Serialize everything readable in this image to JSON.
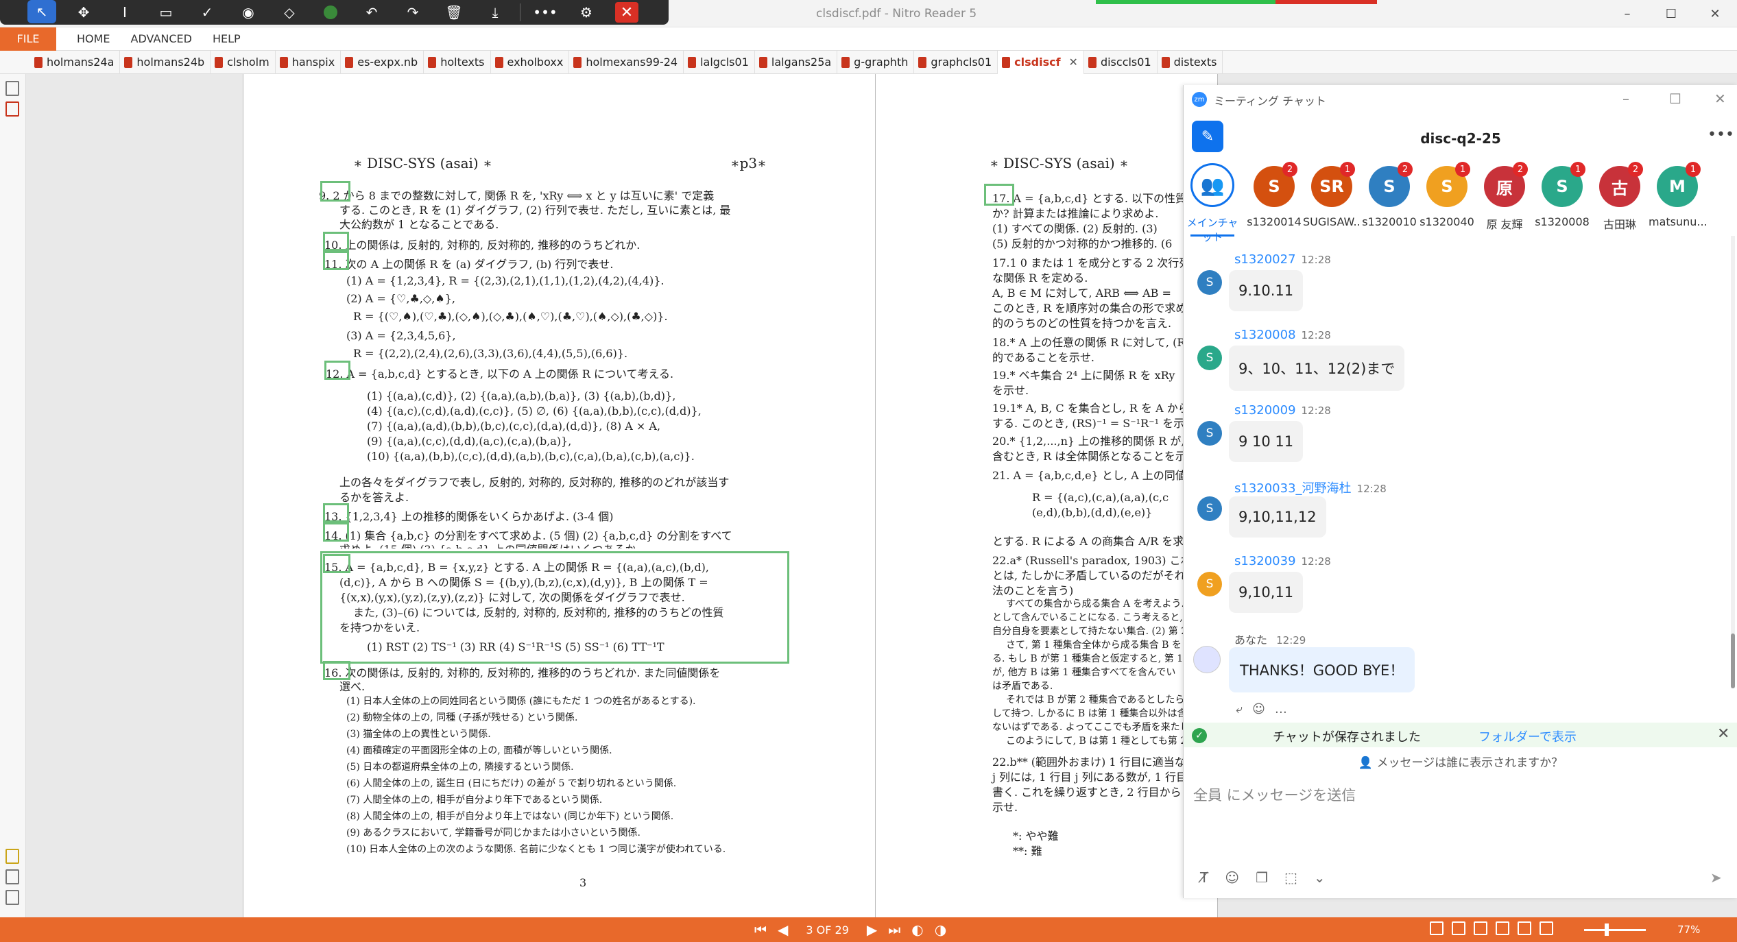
{
  "window": {
    "title": "clsdiscf.pdf - Nitro Reader 5",
    "controls": [
      "–",
      "☐",
      "✕"
    ]
  },
  "floating_toolbar": {
    "icons": [
      "pointer-icon",
      "pan-icon",
      "text-cursor-icon",
      "rectangle-icon",
      "check-icon",
      "record-icon",
      "eraser-icon",
      "color-dot-icon",
      "undo-icon",
      "redo-icon",
      "delete-icon",
      "download-icon",
      "more-icon",
      "user-settings-icon",
      "close-icon"
    ]
  },
  "ribbon": {
    "file": "FILE",
    "tabs": [
      "HOME",
      "ADVANCED",
      "HELP"
    ]
  },
  "doc_tabs": [
    {
      "label": "holmans24a",
      "active": false
    },
    {
      "label": "holmans24b",
      "active": false
    },
    {
      "label": "clsholm",
      "active": false
    },
    {
      "label": "hanspix",
      "active": false
    },
    {
      "label": "es-expx.nb",
      "active": false
    },
    {
      "label": "holtexts",
      "active": false
    },
    {
      "label": "exholboxx",
      "active": false
    },
    {
      "label": "holmexans99-24",
      "active": false
    },
    {
      "label": "lalgcls01",
      "active": false
    },
    {
      "label": "lalgans25a",
      "active": false
    },
    {
      "label": "g-graphth",
      "active": false
    },
    {
      "label": "graphcls01",
      "active": false
    },
    {
      "label": "clsdiscf",
      "active": true
    },
    {
      "label": "disccls01",
      "active": false
    },
    {
      "label": "distexts",
      "active": false
    }
  ],
  "page_left": {
    "header_left": "∗ DISC-SYS (asai) ∗",
    "header_right": "∗p3∗",
    "lines": [
      "9. 2 から 8 までの整数に対して, 関係 R を, 'xRy ⟺ x と y は互いに素' で定義",
      "する. このとき, R を (1) ダイグラフ, (2) 行列で表せ. ただし, 互いに素とは, 最",
      "大公約数が 1 となることである.",
      "10. 上の関係は, 反射的, 対称的, 反対称的, 推移的のうちどれか.",
      "11. 次の A 上の関係 R を (a) ダイグラフ, (b) 行列で表せ.",
      "(1) A = {1,2,3,4}, R = {(2,3),(2,1),(1,1),(1,2),(4,2),(4,4)}.",
      "(2) A = {♡,♣,◇,♠},",
      "R = {(♡,♠),(♡,♣),(◇,♠),(◇,♣),(♠,♡),(♣,♡),(♠,◇),(♣,◇)}.",
      "(3) A = {2,3,4,5,6},",
      "R = {(2,2),(2,4),(2,6),(3,3),(3,6),(4,4),(5,5),(6,6)}.",
      "12. A = {a,b,c,d} とするとき, 以下の A 上の関係 R について考える.",
      "(1) {(a,a),(c,d)},   (2) {(a,a),(a,b),(b,a)},   (3) {(a,b),(b,d)},",
      "(4) {(a,c),(c,d),(a,d),(c,c)},   (5) ∅,   (6) {(a,a),(b,b),(c,c),(d,d)},",
      "(7) {(a,a),(a,d),(b,b),(b,c),(c,c),(d,a),(d,d)},   (8) A × A,",
      "(9) {(a,a),(c,c),(d,d),(a,c),(c,a),(b,a)},",
      "(10) {(a,a),(b,b),(c,c),(d,d),(a,b),(b,c),(c,a),(b,a),(c,b),(a,c)}.",
      "上の各々をダイグラフで表し, 反射的, 対称的, 反対称的, 推移的のどれが該当す",
      "るかを答えよ.",
      "13. {1,2,3,4} 上の推移的関係をいくらかあげよ. (3-4 個)",
      "14. (1) 集合 {a,b,c} の分割をすべて求めよ. (5 個) (2) {a,b,c,d} の分割をすべて",
      "求めよ. (15 個) (3) {a,b,c,d} 上の同値関係はいくつあるか.",
      "15. A = {a,b,c,d}, B = {x,y,z} とする. A 上の関係 R = {(a,a),(a,c),(b,d),",
      "(d,c)}, A から B への関係 S = {(b,y),(b,z),(c,x),(d,y)}, B 上の関係 T =",
      "{(x,x),(y,x),(y,z),(z,y),(z,z)} に対して, 次の関係をダイグラフで表せ.",
      "また, (3)–(6) については, 反射的, 対称的, 反対称的, 推移的のうちどの性質",
      "を持つかをいえ.",
      "(1) RST   (2) TS⁻¹   (3) RR   (4) S⁻¹R⁻¹S   (5) SS⁻¹   (6) TT⁻¹T",
      "16. 次の関係は, 反射的, 対称的, 反対称的, 推移的のうちどれか. また同値関係を",
      "選べ.",
      "(1) 日本人全体の上の同姓同名という関係 (誰にもただ 1 つの姓名があるとする).",
      "(2) 動物全体の上の, 同種 (子孫が残せる) という関係.",
      "(3) 猫全体の上の異性という関係.",
      "(4) 面積確定の平面図形全体の上の, 面積が等しいという関係.",
      "(5) 日本の都道府県全体の上の, 隣接するという関係.",
      "(6) 人間全体の上の, 誕生日 (日にちだけ) の差が 5 で割り切れるという関係.",
      "(7) 人間全体の上の, 相手が自分より年下であるという関係.",
      "(8) 人間全体の上の, 相手が自分より年上ではない (同じか年下) という関係.",
      "(9) あるクラスにおいて, 学籍番号が同じかまたは小さいという関係.",
      "(10) 日本人全体の上の次のような関係. 名前に少なくとも 1 つ同じ漢字が使われている."
    ],
    "page_number": "3"
  },
  "page_right": {
    "header_left": "∗ DISC-SYS (asai) ∗",
    "lines": [
      "17. A = {a,b,c,d} とする. 以下の性質",
      "か? 計算または推論により求めよ.",
      "(1) すべての関係. (2) 反射的. (3)",
      "(5) 反射的かつ対称的かつ推移的. (6",
      "17.1  0 または 1 を成分とする 2 次行列全",
      "な関係 R を定める.",
      "A, B ∈ M に対して, ARB ⟺ AB =",
      "このとき, R を順序対の集合の形で求め",
      "的のうちのどの性質を持つかを言え.",
      "18.* A 上の任意の関係 R に対して, (R",
      "的であることを示せ.",
      "19.* ベキ集合 2⁴ 上に関係 R を xRy ",
      "を示せ.",
      "19.1* A, B, C を集合とし, R を A から",
      "する. このとき, (RS)⁻¹ = S⁻¹R⁻¹ を示",
      "20.* {1,2,...,n} 上の推移的関係 R が,",
      "含むとき, R は全体関係となることを示",
      "21. A = {a,b,c,d,e} とし, A 上の同値関",
      "R = {(a,c),(c,a),(a,a),(c,c",
      "(e,d),(b,b),(d,d),(e,e)}",
      "とする. R による A の商集合 A/R を求",
      "22.a* (Russell's paradox, 1903) これは集",
      "とは, たしかに矛盾しているのだがそれ",
      "法のことを言う)",
      "すべての集合から成る集合 A を考えよう.",
      "として含んでいることになる. こう考えると,",
      "自分自身を要素として持たない集合. (2) 第 2",
      "さて, 第 1 種集合全体から成る集合 B を",
      "る. もし B が第 1 種集合と仮定すると, 第 1",
      "が, 他方 B は第 1 種集合すべてを含んでい",
      "は矛盾である.",
      "それでは B が第 2 種集合であるとしたら",
      "して持つ. しかるに B は第 1 種集合以外は含",
      "ないはずである. よってここでも矛盾を来たし",
      "このようにして, B は第 1 種としても第 2",
      "22.b** (範囲外おまけ) 1 行目に適当な",
      "j 列には, 1 行目 j 列にある数が, 1 行目",
      "書く. これを繰り返すとき, 2 行目から",
      "示せ.",
      "*: やや難",
      "**: 難"
    ]
  },
  "statusbar": {
    "page_indicator": "3 OF 29",
    "zoom": "77%"
  },
  "zoom_chat": {
    "window_title": "ミーティング チャット",
    "logo": "zm",
    "channel_name": "disc-q2-25",
    "main_chat_label": "メインチャット",
    "participants": [
      {
        "initial": "S",
        "name": "s1320014",
        "badge": "2",
        "color": "#d4500f"
      },
      {
        "initial": "SR",
        "name": "SUGISAW...",
        "badge": "1",
        "color": "#d4500f"
      },
      {
        "initial": "S",
        "name": "s1320010",
        "badge": "2",
        "color": "#2f7fc1"
      },
      {
        "initial": "S",
        "name": "s1320040",
        "badge": "1",
        "color": "#f0a020"
      },
      {
        "initial": "原",
        "name": "原 友輝",
        "badge": "2",
        "color": "#c8323a"
      },
      {
        "initial": "S",
        "name": "s1320008",
        "badge": "1",
        "color": "#2aa88a"
      },
      {
        "initial": "古",
        "name": "古田琳",
        "badge": "2",
        "color": "#c8323a"
      },
      {
        "initial": "M",
        "name": "matsunu...",
        "badge": "1",
        "color": "#2aa88a"
      }
    ],
    "messages": [
      {
        "sender": "s1320027",
        "time": "12:28",
        "text": "9.10.11",
        "initial": "S",
        "color": "#2f7fc1"
      },
      {
        "sender": "s1320008",
        "time": "12:28",
        "text": "9、10、11、12(2)まで",
        "initial": "S",
        "color": "#2aa88a"
      },
      {
        "sender": "s1320009",
        "time": "12:28",
        "text": "9 10 11",
        "initial": "S",
        "color": "#2f7fc1"
      },
      {
        "sender": "s1320033_河野海杜",
        "time": "12:28",
        "text": "9,10,11,12",
        "initial": "S",
        "color": "#2f7fc1"
      },
      {
        "sender": "s1320039",
        "time": "12:28",
        "text": "9,10,11",
        "initial": "S",
        "color": "#f0a020"
      }
    ],
    "own_message": {
      "sender": "あなた",
      "time": "12:29",
      "text": "THANKS！GOOD BYE！"
    },
    "saved_notice": "チャットが保存されました",
    "saved_link": "フォルダーで表示",
    "who_can_see": "メッセージは誰に表示されますか？",
    "input_placeholder": "全員 にメッセージを送信"
  }
}
